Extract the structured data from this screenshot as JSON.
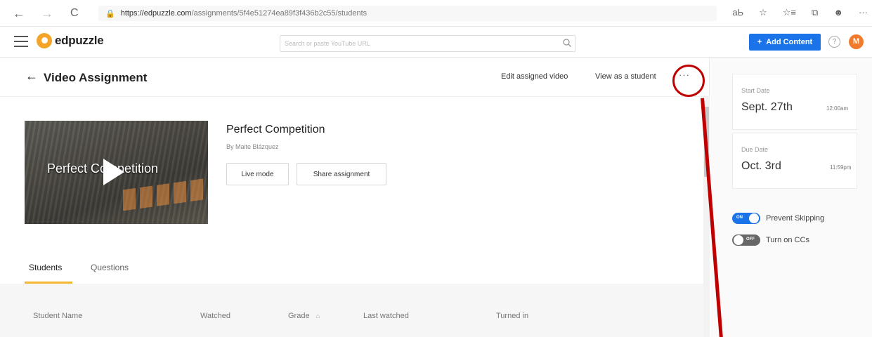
{
  "browser": {
    "url_host": "https://edpuzzle.com",
    "url_path": "/assignments/5f4e51274ea89f3f436b2c55/students",
    "back": "←",
    "forward": "→",
    "reload": "C",
    "lock": "🔒",
    "icons": [
      "аЬ",
      "☆",
      "☆≡",
      "⧉",
      "☻",
      "···"
    ]
  },
  "header": {
    "logo_text": "edpuzzle",
    "search_placeholder": "Search or paste YouTube URL",
    "search_icon": "search-icon",
    "add_content_label": "Add Content",
    "add_plus": "+",
    "help": "?",
    "avatar_initial": "M"
  },
  "assignment": {
    "back": "←",
    "title": "Video Assignment",
    "edit_link": "Edit assigned video",
    "view_link": "View as a student",
    "more": "···"
  },
  "video": {
    "thumb_title": "Perfect Competition",
    "title": "Perfect Competition",
    "author": "By Maite Blázquez",
    "live_mode": "Live mode",
    "share": "Share assignment"
  },
  "tabs": [
    {
      "label": "Students",
      "active": true
    },
    {
      "label": "Questions",
      "active": false
    }
  ],
  "table": {
    "columns": [
      "Student Name",
      "Watched",
      "Grade",
      "Last watched",
      "Turned in"
    ],
    "sort_icon": "⌂"
  },
  "sidebar": {
    "start_label": "Start Date",
    "start_date": "Sept. 27th",
    "start_time": "12:00am",
    "due_label": "Due Date",
    "due_date": "Oct. 3rd",
    "due_time": "11:59pm",
    "prevent_skipping": {
      "label": "Prevent Skipping",
      "state": "ON"
    },
    "captions": {
      "label": "Turn on CCs",
      "state": "OFF"
    }
  },
  "colors": {
    "accent": "#1a73e8",
    "tab_underline": "#f5b731",
    "annotation": "#c00000",
    "avatar": "#f07b2c"
  }
}
